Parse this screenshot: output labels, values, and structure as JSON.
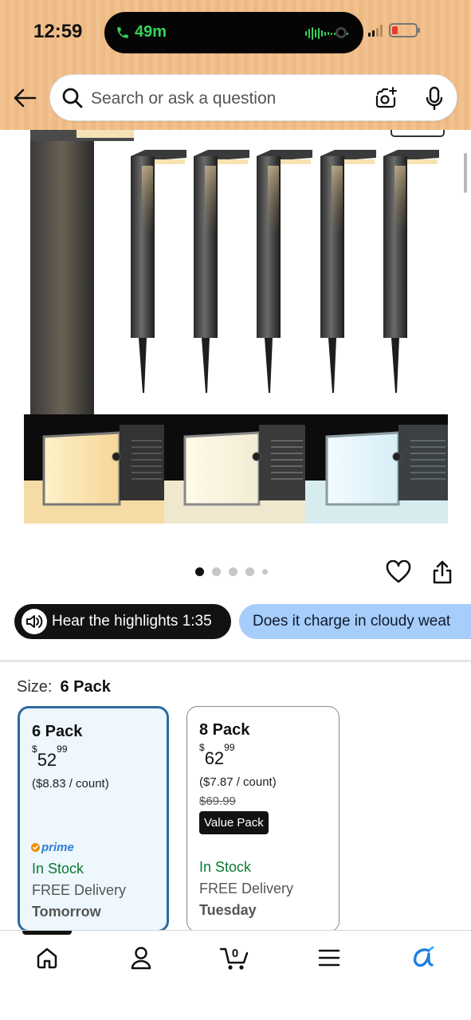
{
  "status_bar": {
    "time": "12:59",
    "call_duration": "49m"
  },
  "search": {
    "placeholder": "Search or ask a question"
  },
  "gallery": {
    "image_count": 5,
    "current_index": 0
  },
  "chips": {
    "hear_highlights": "Hear the highlights 1:35",
    "question": "Does it charge in cloudy weat"
  },
  "size": {
    "label": "Size:",
    "selected": "6 Pack"
  },
  "options": [
    {
      "name": "6 Pack",
      "price_symbol": "$",
      "price_whole": "52",
      "price_fraction": "99",
      "per_unit": "($8.83 / count)",
      "prime": "prime",
      "stock": "In Stock",
      "delivery": "FREE Delivery",
      "delivery_day": "Tomorrow"
    },
    {
      "name": "8 Pack",
      "price_symbol": "$",
      "price_whole": "62",
      "price_fraction": "99",
      "per_unit": "($7.87 / count)",
      "list_price": "$69.99",
      "badge": "Value Pack",
      "stock": "In Stock",
      "delivery": "FREE Delivery",
      "delivery_day": "Tuesday"
    }
  ],
  "colors": {
    "header_bg": "#f1c28f",
    "selected_border": "#2d6aa0",
    "in_stock": "#0a7a32",
    "chip_question_bg": "#a7cdfa",
    "prime_blue": "#2f7ed8"
  },
  "bottom_nav": {
    "items": [
      "home-icon",
      "account-icon",
      "cart-icon",
      "menu-icon",
      "rufus-icon"
    ],
    "cart_count": "0"
  }
}
